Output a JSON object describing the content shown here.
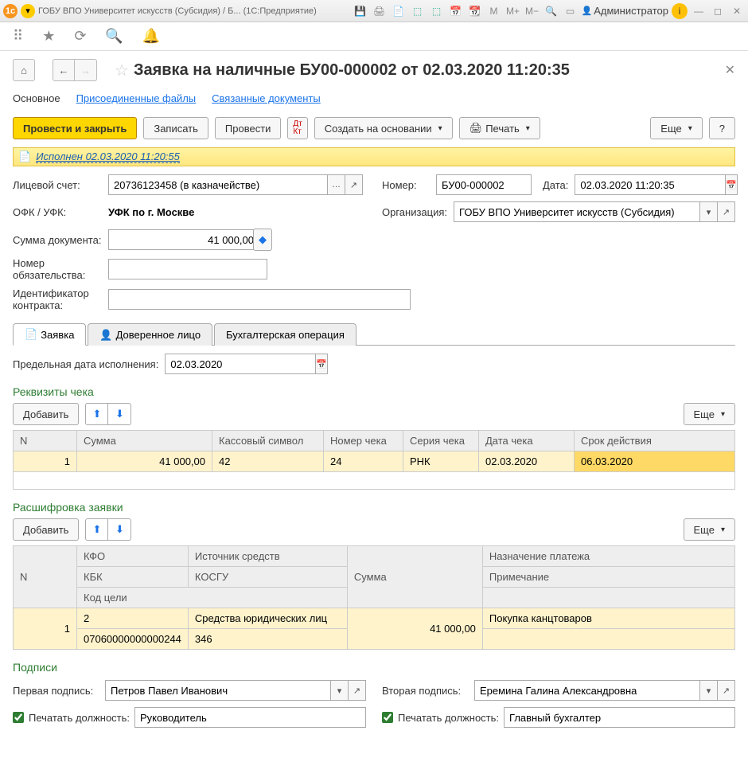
{
  "titlebar": {
    "app_icon": "1c",
    "title": "ГОБУ ВПО Университет искусств (Субсидия) / Б...   (1С:Предприятие)",
    "user": "Администратор",
    "icons": {
      "m": "M",
      "m_plus": "M+",
      "m_minus": "M−"
    }
  },
  "header": {
    "doc_title": "Заявка на наличные БУ00-000002 от 02.03.2020 11:20:35"
  },
  "navtabs": {
    "main": "Основное",
    "files": "Присоединенные файлы",
    "related": "Связанные документы"
  },
  "cmd": {
    "post_close": "Провести и закрыть",
    "save": "Записать",
    "post": "Провести",
    "create_based": "Создать на основании",
    "print": "Печать",
    "more": "Еще",
    "help": "?"
  },
  "status": {
    "text": "Исполнен 02.03.2020 11:20:55"
  },
  "form": {
    "lic_lbl": "Лицевой счет:",
    "lic_val": "20736123458 (в казначействе)",
    "num_lbl": "Номер:",
    "num_val": "БУ00-000002",
    "date_lbl": "Дата:",
    "date_val": "02.03.2020 11:20:35",
    "ofk_lbl": "ОФК / УФК:",
    "ofk_val": "УФК по г. Москве",
    "org_lbl": "Организация:",
    "org_val": "ГОБУ ВПО Университет искусств (Субсидия)",
    "sum_lbl": "Сумма документа:",
    "sum_val": "41 000,00",
    "oblig_lbl": "Номер обязательства:",
    "contract_lbl": "Идентификатор контракта:"
  },
  "tabs": {
    "req": "Заявка",
    "proxy": "Доверенное лицо",
    "acc_op": "Бухгалтерская операция"
  },
  "request": {
    "deadline_lbl": "Предельная дата исполнения:",
    "deadline_val": "02.03.2020",
    "check_title": "Реквизиты чека",
    "add": "Добавить",
    "more": "Еще",
    "cols": {
      "n": "N",
      "sum": "Сумма",
      "sym": "Кассовый символ",
      "chk_num": "Номер чека",
      "chk_ser": "Серия чека",
      "chk_date": "Дата чека",
      "valid": "Срок действия"
    },
    "row": {
      "n": "1",
      "sum": "41 000,00",
      "sym": "42",
      "chk_num": "24",
      "chk_ser": "РНК",
      "chk_date": "02.03.2020",
      "valid": "06.03.2020"
    }
  },
  "detail": {
    "title": "Расшифровка заявки",
    "hdrs": {
      "n": "N",
      "kfo": "КФО",
      "src": "Источник средств",
      "sum": "Сумма",
      "purpose": "Назначение платежа",
      "kbk": "КБК",
      "kosgu": "КОСГУ",
      "note": "Примечание",
      "goal": "Код цели"
    },
    "row": {
      "n": "1",
      "kfo": "2",
      "src": "Средства юридических лиц",
      "sum": "41 000,00",
      "purpose": "Покупка канцтоваров",
      "kbk": "07060000000000244",
      "kosgu": "346"
    }
  },
  "sign": {
    "title": "Подписи",
    "sig1_lbl": "Первая подпись:",
    "sig1_val": "Петров Павел Иванович",
    "sig2_lbl": "Вторая подпись:",
    "sig2_val": "Еремина Галина Александровна",
    "print_pos_lbl": "Печатать должность:",
    "pos1": "Руководитель",
    "pos2": "Главный бухгалтер"
  }
}
